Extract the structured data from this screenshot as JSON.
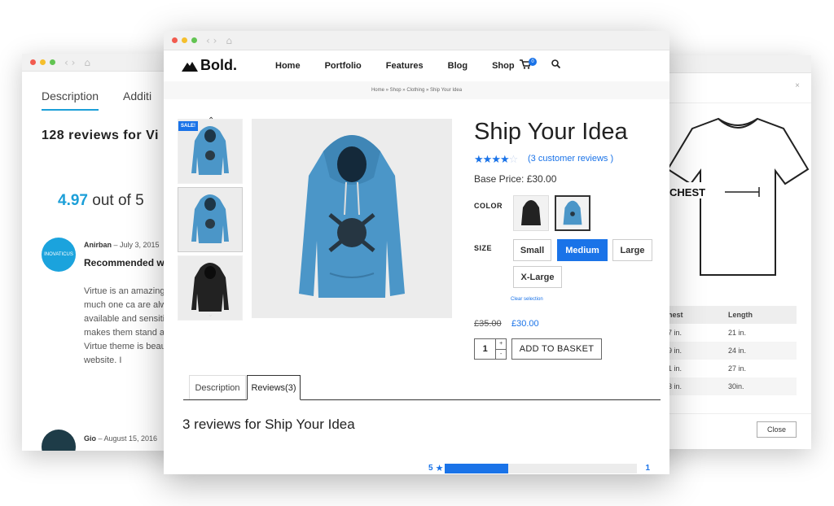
{
  "left_window": {
    "tabs": [
      "Description",
      "Additi"
    ],
    "reviews_title": "128 reviews for Vi",
    "rating_value": "4.97",
    "rating_suffix": " out of 5",
    "review1": {
      "avatar_text": "INOVATICUS",
      "author": "Anirban",
      "date": " – July 3, 2015",
      "heading": "Recommended website.",
      "body": "Virtue is an amazing to how much one ca are always available and sensitive appro makes them stand a The Virtue theme is beautiful website. I"
    },
    "review2": {
      "author": "Gio",
      "date": " – August 15, 2016"
    }
  },
  "right_window": {
    "close_x": "×",
    "chest_label": "CHEST",
    "table": {
      "headers": [
        "hest",
        "Length"
      ],
      "rows": [
        [
          "7 in.",
          "21 in."
        ],
        [
          "9 in.",
          "24 in."
        ],
        [
          "1 in.",
          "27 in."
        ],
        [
          "3 in.",
          "30in."
        ]
      ]
    },
    "close_button": "Close"
  },
  "main_window": {
    "logo": "Bold.",
    "menu": [
      "Home",
      "Portfolio",
      "Features",
      "Blog",
      "Shop"
    ],
    "cart_count": "0",
    "breadcrumb": "Home » Shop » Clothing » Ship Your Idea",
    "sale_badge": "SALE!",
    "product": {
      "name": "Ship Your Idea",
      "rating": 4,
      "rating_max": 5,
      "review_link": "(3 customer reviews )",
      "base_price": "Base Price: £30.00",
      "color_label": "COLOR",
      "size_label": "SIZE",
      "sizes": [
        "Small",
        "Medium",
        "Large",
        "X-Large"
      ],
      "selected_size": "Medium",
      "clear_selection": "Clear selection",
      "old_price": "£35.00",
      "new_price": "£30.00",
      "quantity": "1",
      "qty_plus": "+",
      "qty_minus": "-",
      "add_to_basket": "ADD TO BASKET"
    },
    "tabs": [
      "Description",
      "Reviews(3)"
    ],
    "active_tab": "Reviews(3)",
    "reviews_title": "3 reviews for Ship Your Idea",
    "rating_bar": {
      "label": "5",
      "fraction": 0.33,
      "count": "1"
    }
  },
  "colors": {
    "accent_blue": "#1a73e8",
    "left_accent": "#1c9fd8",
    "hoodie_blue": "#4b96c8"
  }
}
